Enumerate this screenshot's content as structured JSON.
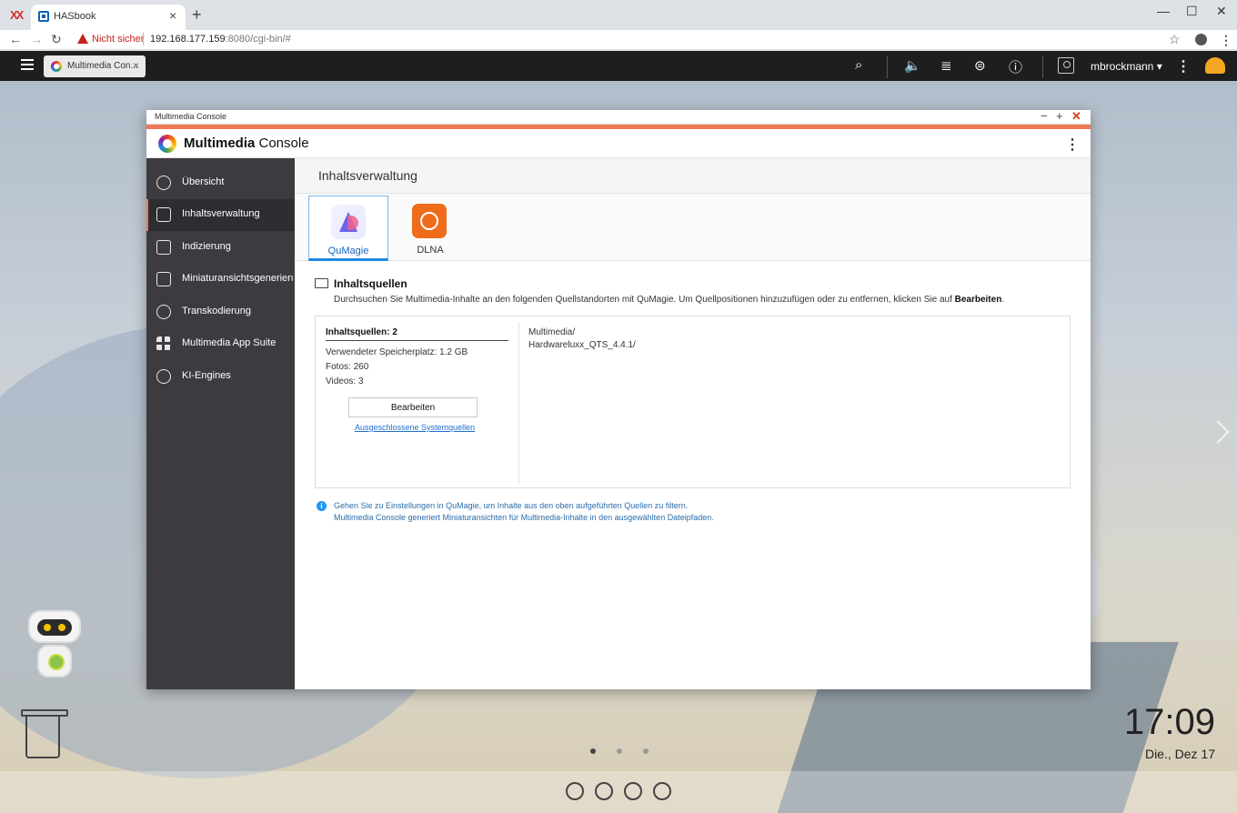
{
  "browser": {
    "tab_title": "HASbook",
    "warning": "Nicht sicher",
    "url_host": "192.168.177.159",
    "url_rest": ":8080/cgi-bin/#"
  },
  "qts": {
    "app_tab": "Multimedia Con...",
    "user": "mbrockmann ▾"
  },
  "window": {
    "title": "Multimedia Console",
    "app_name_bold": "Multimedia",
    "app_name_rest": " Console"
  },
  "sidebar": {
    "items": [
      {
        "label": "Übersicht",
        "icon": "gauge-icon"
      },
      {
        "label": "Inhaltsverwaltung",
        "icon": "content-search-icon"
      },
      {
        "label": "Indizierung",
        "icon": "clipboard-icon"
      },
      {
        "label": "Miniaturansichtsgenerieru...",
        "icon": "image-icon"
      },
      {
        "label": "Transkodierung",
        "icon": "transcode-icon"
      },
      {
        "label": "Multimedia App Suite",
        "icon": "apps-grid-icon"
      },
      {
        "label": "KI-Engines",
        "icon": "ai-engine-icon"
      }
    ],
    "active_index": 1
  },
  "main": {
    "title": "Inhaltsverwaltung",
    "tabs": [
      {
        "label": "QuMagie"
      },
      {
        "label": "DLNA"
      }
    ],
    "section_title": "Inhaltsquellen",
    "section_desc": "Durchsuchen Sie Multimedia-Inhalte an den folgenden Quellstandorten mit QuMagie. Um Quellpositionen hinzuzufügen oder zu entfernen, klicken Sie auf ",
    "section_desc_bold": "Bearbeiten",
    "section_desc_end": ".",
    "sources_count": "Inhaltsquellen: 2",
    "storage": "Verwendeter Speicherplatz:  1.2 GB",
    "photos": "Fotos:  260",
    "videos": "Videos:  3",
    "edit_button": "Bearbeiten",
    "excluded_link": "Ausgeschlossene Systemquellen",
    "paths": [
      "Multimedia/",
      "Hardwareluxx_QTS_4.4.1/"
    ],
    "info_lines": [
      "Gehen Sie zu Einstellungen in QuMagie, um Inhalte aus den oben aufgeführten Quellen zu filtern.",
      "Multimedia Console generiert Miniaturansichten für Multimedia-Inhalte in den ausgewählten Dateipfaden."
    ]
  },
  "desktop": {
    "time": "17:09",
    "date": "Die., Dez 17"
  }
}
